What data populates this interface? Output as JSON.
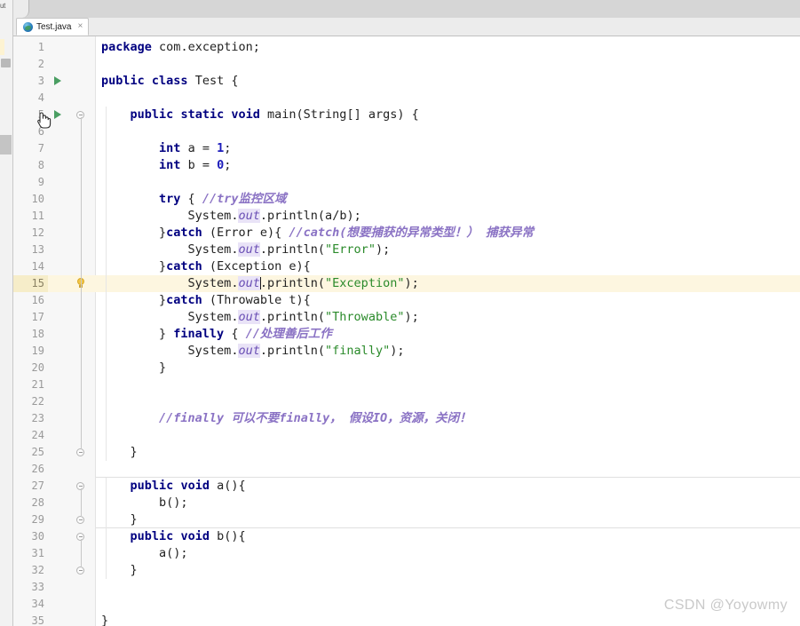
{
  "window": {
    "left_strip_label": "ut"
  },
  "tab": {
    "label": "Test.java",
    "close_glyph": "×",
    "icon": "java-class-icon"
  },
  "editor": {
    "language": "java",
    "highlighted_line": 15,
    "caret_line": 15,
    "colors": {
      "keyword": "#000080",
      "string": "#2a8a2a",
      "comment": "#8a72c4",
      "field": "#6a4fb5",
      "number": "#1b1bbb",
      "line_highlight": "#fdf6e0",
      "gutter_bg": "#f7f7f7",
      "run_arrow": "#4a9e62"
    },
    "lines": [
      {
        "n": 1,
        "text": "package com.exception;"
      },
      {
        "n": 2,
        "text": ""
      },
      {
        "n": 3,
        "text": "public class Test {",
        "run_arrow": true
      },
      {
        "n": 4,
        "text": ""
      },
      {
        "n": 5,
        "text": "    public static void main(String[] args) {",
        "run_arrow": true,
        "fold": "minus"
      },
      {
        "n": 6,
        "text": ""
      },
      {
        "n": 7,
        "text": "        int a = 1;"
      },
      {
        "n": 8,
        "text": "        int b = 0;"
      },
      {
        "n": 9,
        "text": ""
      },
      {
        "n": 10,
        "text": "        try { //try监控区域"
      },
      {
        "n": 11,
        "text": "            System.out.println(a/b);"
      },
      {
        "n": 12,
        "text": "        }catch (Error e){ //catch(想要捕获的异常类型！） 捕获异常"
      },
      {
        "n": 13,
        "text": "            System.out.println(\"Error\");"
      },
      {
        "n": 14,
        "text": "        }catch (Exception e){"
      },
      {
        "n": 15,
        "text": "            System.out.println(\"Exception\");",
        "highlight": true,
        "bulb": true
      },
      {
        "n": 16,
        "text": "        }catch (Throwable t){"
      },
      {
        "n": 17,
        "text": "            System.out.println(\"Throwable\");"
      },
      {
        "n": 18,
        "text": "        } finally { //处理善后工作"
      },
      {
        "n": 19,
        "text": "            System.out.println(\"finally\");"
      },
      {
        "n": 20,
        "text": "        }"
      },
      {
        "n": 21,
        "text": ""
      },
      {
        "n": 22,
        "text": ""
      },
      {
        "n": 23,
        "text": "        //finally 可以不要finally， 假设IO，资源，关闭！"
      },
      {
        "n": 24,
        "text": ""
      },
      {
        "n": 25,
        "text": "    }",
        "fold": "minus"
      },
      {
        "n": 26,
        "text": ""
      },
      {
        "n": 27,
        "text": "    public void a(){",
        "fold": "minus"
      },
      {
        "n": 28,
        "text": "        b();"
      },
      {
        "n": 29,
        "text": "    }",
        "fold": "minus"
      },
      {
        "n": 30,
        "text": "    public void b(){",
        "fold": "minus"
      },
      {
        "n": 31,
        "text": "        a();"
      },
      {
        "n": 32,
        "text": "    }",
        "fold": "minus"
      },
      {
        "n": 33,
        "text": ""
      },
      {
        "n": 34,
        "text": ""
      },
      {
        "n": 35,
        "text": "}"
      }
    ]
  },
  "watermark": {
    "text": "CSDN @Yoyowmy"
  }
}
